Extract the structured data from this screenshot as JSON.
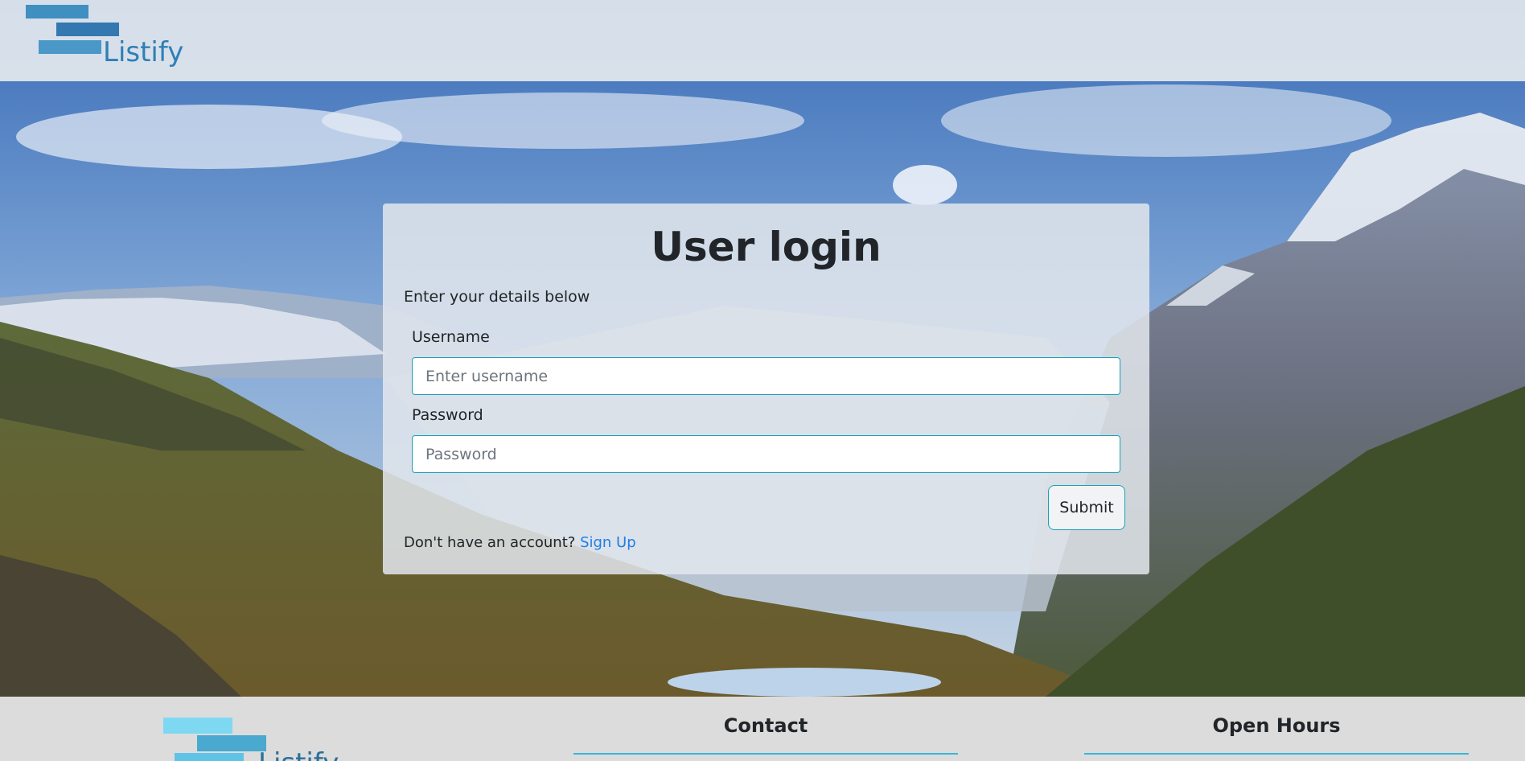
{
  "header": {
    "logo_text": "Listify"
  },
  "login": {
    "title": "User login",
    "subtitle": "Enter your details below",
    "username_label": "Username",
    "username_placeholder": "Enter username",
    "username_value": "",
    "password_label": "Password",
    "password_placeholder": "Password",
    "password_value": "",
    "submit_label": "Submit",
    "signup_prompt": "Don't have an account?",
    "signup_link": "Sign Up"
  },
  "footer": {
    "logo_text": "Listify",
    "contact_heading": "Contact",
    "hours_heading": "Open Hours"
  },
  "colors": {
    "accent": "#17a2b8",
    "link": "#1e7fe6",
    "logo_blue": "#2f7fb6",
    "footer_bg": "#dcdcdc"
  }
}
